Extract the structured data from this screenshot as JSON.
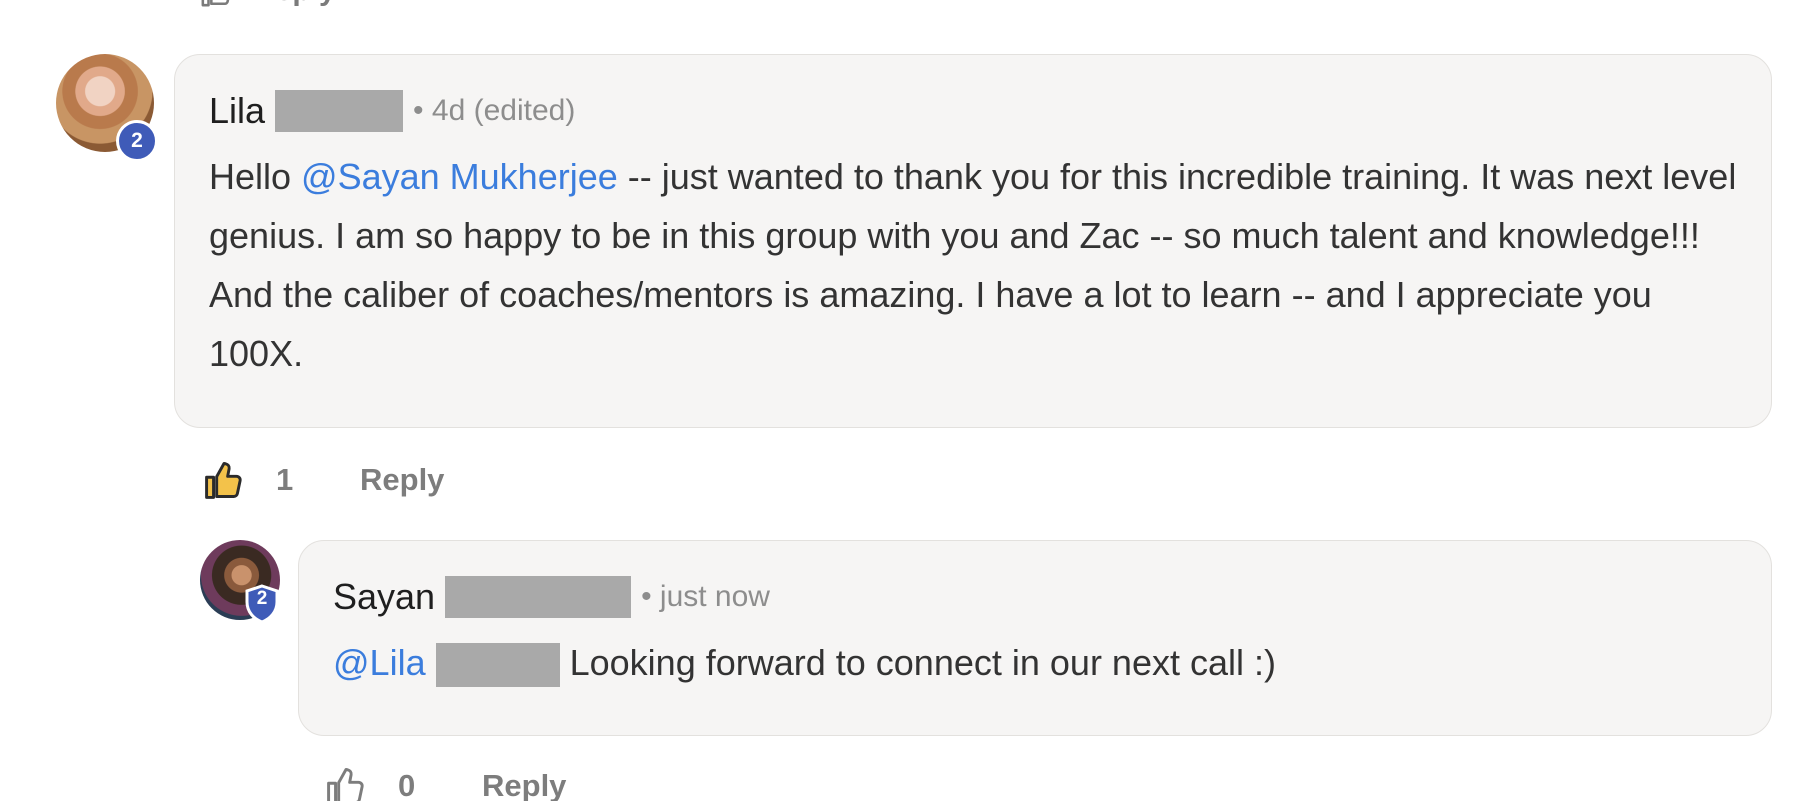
{
  "top_row": {
    "reply_label": "Reply"
  },
  "comments": [
    {
      "author_first": "Lila",
      "time": "• 4d (edited)",
      "level_badge": "2",
      "body": {
        "prefix": "Hello ",
        "mention": "@Sayan Mukherjee",
        "text": " -- just wanted to thank you for this incredible training. It was next level genius. I am so happy to be in this group with you and Zac -- so much talent and knowledge!!! And the caliber of coaches/mentors is amazing. I have a lot to learn -- and I appreciate you 100X."
      },
      "likes": "1",
      "liked": true,
      "reply_label": "Reply"
    },
    {
      "author_first": "Sayan",
      "time": "• just now",
      "level_badge": "2",
      "body": {
        "mention": "@Lila",
        "text": "Looking forward to connect in our next call :)"
      },
      "likes": "0",
      "liked": false,
      "reply_label": "Reply"
    }
  ],
  "colors": {
    "mention": "#3b7ddd",
    "badge": "#3f5bb8",
    "bubble": "#f6f5f4",
    "muted": "#7d7d7d"
  },
  "icons": {
    "like": "thumbs-up-icon",
    "level_badge_round": "level-badge-circle",
    "level_badge_shield": "level-badge-shield"
  }
}
